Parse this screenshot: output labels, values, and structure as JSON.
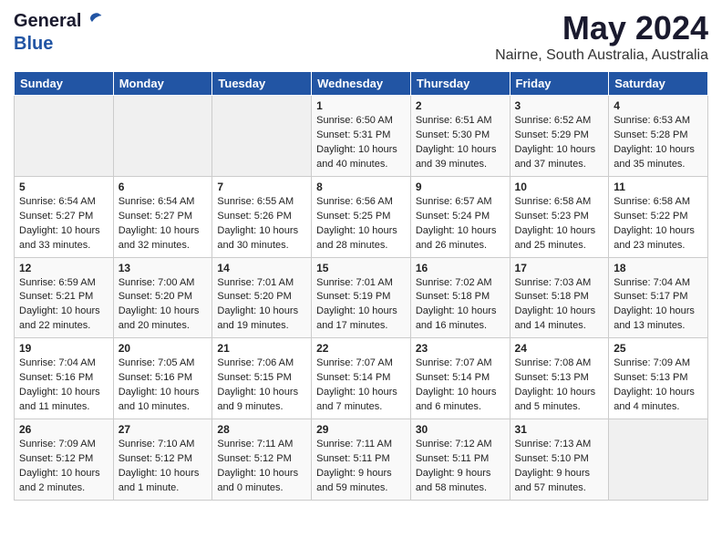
{
  "header": {
    "logo_general": "General",
    "logo_blue": "Blue",
    "month": "May 2024",
    "location": "Nairne, South Australia, Australia"
  },
  "weekdays": [
    "Sunday",
    "Monday",
    "Tuesday",
    "Wednesday",
    "Thursday",
    "Friday",
    "Saturday"
  ],
  "weeks": [
    [
      {
        "day": "",
        "info": ""
      },
      {
        "day": "",
        "info": ""
      },
      {
        "day": "",
        "info": ""
      },
      {
        "day": "1",
        "info": "Sunrise: 6:50 AM\nSunset: 5:31 PM\nDaylight: 10 hours\nand 40 minutes."
      },
      {
        "day": "2",
        "info": "Sunrise: 6:51 AM\nSunset: 5:30 PM\nDaylight: 10 hours\nand 39 minutes."
      },
      {
        "day": "3",
        "info": "Sunrise: 6:52 AM\nSunset: 5:29 PM\nDaylight: 10 hours\nand 37 minutes."
      },
      {
        "day": "4",
        "info": "Sunrise: 6:53 AM\nSunset: 5:28 PM\nDaylight: 10 hours\nand 35 minutes."
      }
    ],
    [
      {
        "day": "5",
        "info": "Sunrise: 6:54 AM\nSunset: 5:27 PM\nDaylight: 10 hours\nand 33 minutes."
      },
      {
        "day": "6",
        "info": "Sunrise: 6:54 AM\nSunset: 5:27 PM\nDaylight: 10 hours\nand 32 minutes."
      },
      {
        "day": "7",
        "info": "Sunrise: 6:55 AM\nSunset: 5:26 PM\nDaylight: 10 hours\nand 30 minutes."
      },
      {
        "day": "8",
        "info": "Sunrise: 6:56 AM\nSunset: 5:25 PM\nDaylight: 10 hours\nand 28 minutes."
      },
      {
        "day": "9",
        "info": "Sunrise: 6:57 AM\nSunset: 5:24 PM\nDaylight: 10 hours\nand 26 minutes."
      },
      {
        "day": "10",
        "info": "Sunrise: 6:58 AM\nSunset: 5:23 PM\nDaylight: 10 hours\nand 25 minutes."
      },
      {
        "day": "11",
        "info": "Sunrise: 6:58 AM\nSunset: 5:22 PM\nDaylight: 10 hours\nand 23 minutes."
      }
    ],
    [
      {
        "day": "12",
        "info": "Sunrise: 6:59 AM\nSunset: 5:21 PM\nDaylight: 10 hours\nand 22 minutes."
      },
      {
        "day": "13",
        "info": "Sunrise: 7:00 AM\nSunset: 5:20 PM\nDaylight: 10 hours\nand 20 minutes."
      },
      {
        "day": "14",
        "info": "Sunrise: 7:01 AM\nSunset: 5:20 PM\nDaylight: 10 hours\nand 19 minutes."
      },
      {
        "day": "15",
        "info": "Sunrise: 7:01 AM\nSunset: 5:19 PM\nDaylight: 10 hours\nand 17 minutes."
      },
      {
        "day": "16",
        "info": "Sunrise: 7:02 AM\nSunset: 5:18 PM\nDaylight: 10 hours\nand 16 minutes."
      },
      {
        "day": "17",
        "info": "Sunrise: 7:03 AM\nSunset: 5:18 PM\nDaylight: 10 hours\nand 14 minutes."
      },
      {
        "day": "18",
        "info": "Sunrise: 7:04 AM\nSunset: 5:17 PM\nDaylight: 10 hours\nand 13 minutes."
      }
    ],
    [
      {
        "day": "19",
        "info": "Sunrise: 7:04 AM\nSunset: 5:16 PM\nDaylight: 10 hours\nand 11 minutes."
      },
      {
        "day": "20",
        "info": "Sunrise: 7:05 AM\nSunset: 5:16 PM\nDaylight: 10 hours\nand 10 minutes."
      },
      {
        "day": "21",
        "info": "Sunrise: 7:06 AM\nSunset: 5:15 PM\nDaylight: 10 hours\nand 9 minutes."
      },
      {
        "day": "22",
        "info": "Sunrise: 7:07 AM\nSunset: 5:14 PM\nDaylight: 10 hours\nand 7 minutes."
      },
      {
        "day": "23",
        "info": "Sunrise: 7:07 AM\nSunset: 5:14 PM\nDaylight: 10 hours\nand 6 minutes."
      },
      {
        "day": "24",
        "info": "Sunrise: 7:08 AM\nSunset: 5:13 PM\nDaylight: 10 hours\nand 5 minutes."
      },
      {
        "day": "25",
        "info": "Sunrise: 7:09 AM\nSunset: 5:13 PM\nDaylight: 10 hours\nand 4 minutes."
      }
    ],
    [
      {
        "day": "26",
        "info": "Sunrise: 7:09 AM\nSunset: 5:12 PM\nDaylight: 10 hours\nand 2 minutes."
      },
      {
        "day": "27",
        "info": "Sunrise: 7:10 AM\nSunset: 5:12 PM\nDaylight: 10 hours\nand 1 minute."
      },
      {
        "day": "28",
        "info": "Sunrise: 7:11 AM\nSunset: 5:12 PM\nDaylight: 10 hours\nand 0 minutes."
      },
      {
        "day": "29",
        "info": "Sunrise: 7:11 AM\nSunset: 5:11 PM\nDaylight: 9 hours\nand 59 minutes."
      },
      {
        "day": "30",
        "info": "Sunrise: 7:12 AM\nSunset: 5:11 PM\nDaylight: 9 hours\nand 58 minutes."
      },
      {
        "day": "31",
        "info": "Sunrise: 7:13 AM\nSunset: 5:10 PM\nDaylight: 9 hours\nand 57 minutes."
      },
      {
        "day": "",
        "info": ""
      }
    ]
  ]
}
